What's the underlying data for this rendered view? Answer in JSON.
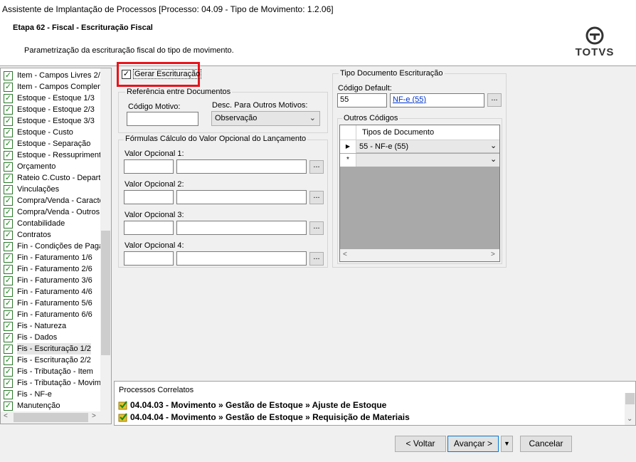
{
  "window": {
    "title": "Assistente de Implantação de Processos [Processo: 04.09 - Tipo de Movimento: 1.2.06]"
  },
  "header": {
    "step_title": "Etapa 62 - Fiscal - Escrituração Fiscal",
    "step_desc": "Parametrização da escrituração fiscal do tipo de movimento.",
    "logo_text": "TOTVS"
  },
  "sidebar": {
    "items": [
      {
        "label": "Item - Campos Livres 2/"
      },
      {
        "label": "Item - Campos Complem"
      },
      {
        "label": "Estoque - Estoque 1/3"
      },
      {
        "label": "Estoque - Estoque 2/3"
      },
      {
        "label": "Estoque - Estoque 3/3"
      },
      {
        "label": "Estoque - Custo"
      },
      {
        "label": "Estoque - Separação"
      },
      {
        "label": "Estoque - Ressupriment"
      },
      {
        "label": "Orçamento"
      },
      {
        "label": "Rateio C.Custo - Depart"
      },
      {
        "label": "Vinculações"
      },
      {
        "label": "Compra/Venda - Caracte"
      },
      {
        "label": "Compra/Venda - Outros"
      },
      {
        "label": "Contabilidade"
      },
      {
        "label": "Contratos"
      },
      {
        "label": "Fin - Condições de Paga"
      },
      {
        "label": "Fin - Faturamento 1/6"
      },
      {
        "label": "Fin - Faturamento 2/6"
      },
      {
        "label": "Fin - Faturamento 3/6"
      },
      {
        "label": "Fin - Faturamento 4/6"
      },
      {
        "label": "Fin - Faturamento 5/6"
      },
      {
        "label": "Fin - Faturamento 6/6"
      },
      {
        "label": "Fis - Natureza"
      },
      {
        "label": "Fis - Dados"
      },
      {
        "label": "Fis - Escrituração 1/2"
      },
      {
        "label": "Fis - Escrituração 2/2"
      },
      {
        "label": "Fis - Tributação - Item"
      },
      {
        "label": "Fis - Tributação - Movim"
      },
      {
        "label": "Fis - NF-e"
      },
      {
        "label": "Manutenção"
      }
    ]
  },
  "fiscal": {
    "gerar_label": "Gerar Escrituração",
    "gerar_checked": true,
    "ref_group": "Referência entre Documentos",
    "codigo_motivo_label": "Código Motivo:",
    "codigo_motivo_value": "",
    "desc_label": "Desc. Para Outros Motivos:",
    "desc_value": "Observação",
    "formulas_group": "Fórmulas Cálculo do Valor Opcional do Lançamento",
    "opcionais": [
      {
        "label": "Valor Opcional 1:"
      },
      {
        "label": "Valor Opcional 2:"
      },
      {
        "label": "Valor Opcional 3:"
      },
      {
        "label": "Valor Opcional 4:"
      }
    ],
    "tipo_group": "Tipo Documento Escrituração",
    "codigo_default_label": "Código Default:",
    "codigo_default_value": "55",
    "codigo_default_desc": "NF-e (55)",
    "outros_group": "Outros Códigos",
    "grid_header": "Tipos de Documento",
    "grid_rows": [
      "55 - NF-e (55)",
      ""
    ],
    "dots": "..."
  },
  "correlatos": {
    "title": "Processos Correlatos",
    "items": [
      "04.04.03 - Movimento » Gestão de Estoque » Ajuste de Estoque",
      "04.04.04 - Movimento » Gestão de Estoque » Requisição de Materiais"
    ]
  },
  "footer": {
    "voltar": "< Voltar",
    "avancar": "Avançar >",
    "cancelar": "Cancelar"
  }
}
